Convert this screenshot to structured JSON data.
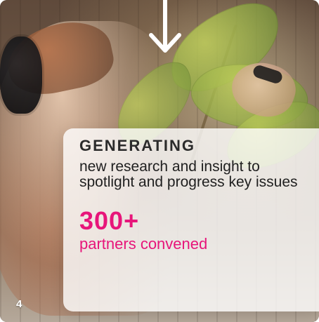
{
  "panel": {
    "kicker": "GENERATING",
    "description": "new research and insight to spotlight and progress key issues",
    "stat_value": "300+",
    "stat_label": "partners convened"
  },
  "page": {
    "number": "4"
  },
  "colors": {
    "accent": "#e7157a",
    "panel_text": "#1f1f1f",
    "arrow": "#ffffff"
  },
  "icons": {
    "arrow": "arrow-down-icon"
  }
}
